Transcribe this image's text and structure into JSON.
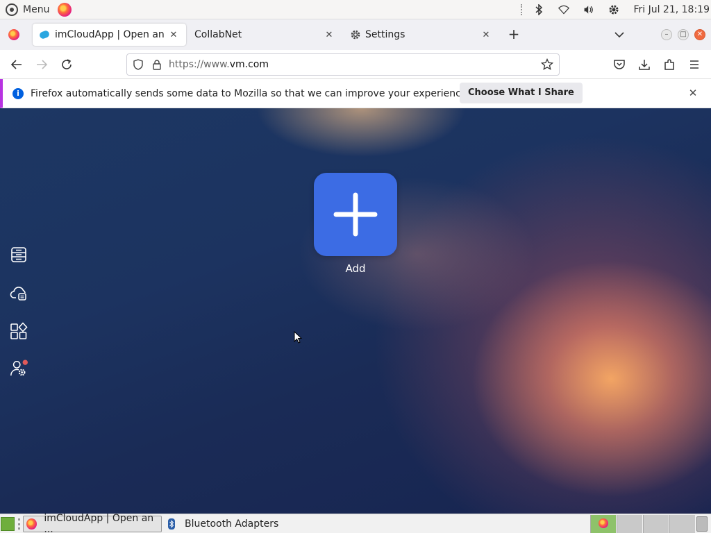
{
  "system_bar": {
    "menu_label": "Menu",
    "clock": "Fri Jul 21, 18:19"
  },
  "tabs": [
    {
      "title": "imCloudApp | Open an e",
      "active": true
    },
    {
      "title": "CollabNet",
      "active": false
    },
    {
      "title": "Settings",
      "active": false
    }
  ],
  "navbar": {
    "url_prefix": "https://www.",
    "url_host": "vm.com"
  },
  "notification": {
    "message": "Firefox automatically sends some data to Mozilla so that we can improve your experience.",
    "button_label": "Choose What I Share"
  },
  "app": {
    "add_label": "Add",
    "sidebar_icons": [
      "storage-icon",
      "cloud-server-icon",
      "apps-icon",
      "user-settings-icon"
    ]
  },
  "taskbar": {
    "tasks": [
      {
        "label": "imCloudApp | Open an ...",
        "active": true
      },
      {
        "label": "Bluetooth Adapters",
        "active": false
      }
    ]
  },
  "colors": {
    "add_button": "#3c6ce4",
    "notification_accent": "#b833e1",
    "badge": "#e05a5a"
  }
}
